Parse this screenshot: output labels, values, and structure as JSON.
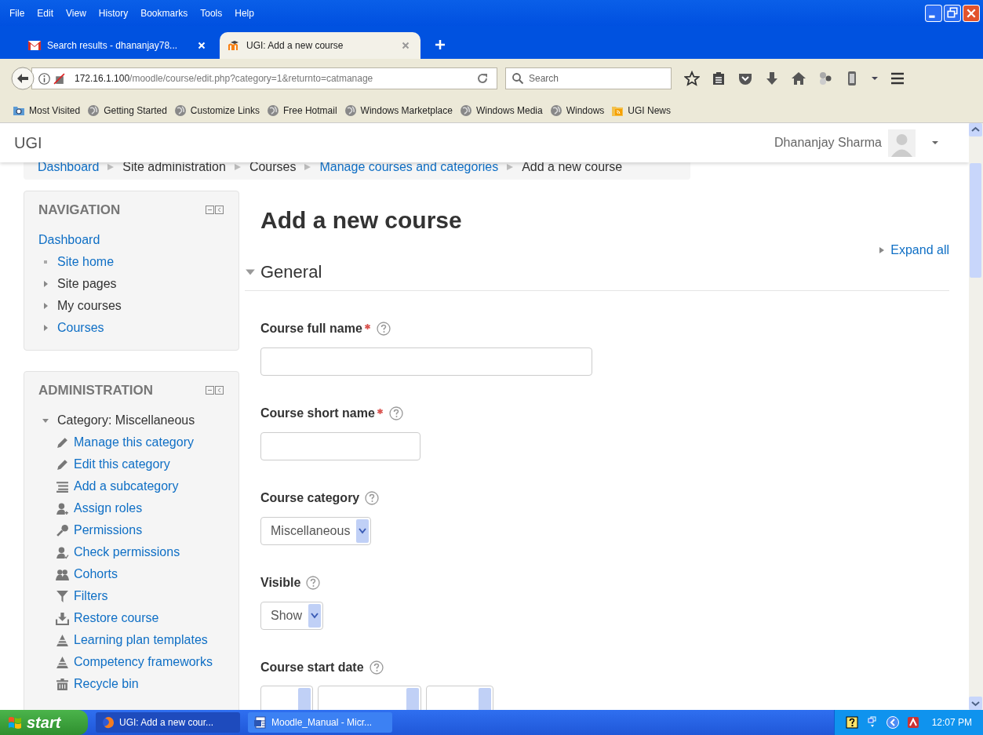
{
  "menu": [
    "File",
    "Edit",
    "View",
    "History",
    "Bookmarks",
    "Tools",
    "Help"
  ],
  "tabs": [
    {
      "title": "Search results - dhananjay78...",
      "kind": "mail",
      "selected": false
    },
    {
      "title": "UGI: Add a new course",
      "kind": "course",
      "selected": true
    }
  ],
  "address": {
    "host": "172.16.1.100",
    "path": "/moodle/course/edit.php?category=1&returnto=catmanage"
  },
  "search": {
    "placeholder": "Search"
  },
  "bookmarks": [
    {
      "label": "Most Visited",
      "kind": "folder"
    },
    {
      "label": "Getting Started",
      "kind": "globe"
    },
    {
      "label": "Customize Links",
      "kind": "globe"
    },
    {
      "label": "Free Hotmail",
      "kind": "globe"
    },
    {
      "label": "Windows Marketplace",
      "kind": "globe"
    },
    {
      "label": "Windows Media",
      "kind": "globe"
    },
    {
      "label": "Windows",
      "kind": "globe"
    },
    {
      "label": "UGI News",
      "kind": "feed"
    }
  ],
  "site": {
    "name": "UGI",
    "user": "Dhananjay Sharma"
  },
  "breadcrumb": [
    {
      "label": "Dashboard",
      "link": true
    },
    {
      "label": "Site administration",
      "link": false
    },
    {
      "label": "Courses",
      "link": false
    },
    {
      "label": "Manage courses and categories",
      "link": true
    },
    {
      "label": "Add a new course",
      "link": false
    }
  ],
  "navigation": {
    "title": "NAVIGATION",
    "items": [
      {
        "label": "Dashboard",
        "kind": "root",
        "link": true,
        "children": [
          {
            "label": "Site home",
            "kind": "leaf",
            "link": true
          },
          {
            "label": "Site pages",
            "kind": "branch",
            "expanded": false,
            "link": false
          },
          {
            "label": "My courses",
            "kind": "branch",
            "expanded": false,
            "link": false
          },
          {
            "label": "Courses",
            "kind": "branch",
            "expanded": false,
            "link": true
          }
        ]
      }
    ]
  },
  "administration": {
    "title": "ADMINISTRATION",
    "items": [
      {
        "label": "Category: Miscellaneous",
        "expanded": true,
        "children": [
          {
            "label": "Manage this category",
            "kind": "edit"
          },
          {
            "label": "Edit this category",
            "kind": "edit"
          },
          {
            "label": "Add a subcategory",
            "kind": "tree"
          },
          {
            "label": "Assign roles",
            "kind": "role"
          },
          {
            "label": "Permissions",
            "kind": "key"
          },
          {
            "label": "Check permissions",
            "kind": "check"
          },
          {
            "label": "Cohorts",
            "kind": "cohort"
          },
          {
            "label": "Filters",
            "kind": "filter"
          },
          {
            "label": "Restore course",
            "kind": "restore"
          },
          {
            "label": "Learning plan templates",
            "kind": "plan"
          },
          {
            "label": "Competency frameworks",
            "kind": "plan"
          },
          {
            "label": "Recycle bin",
            "kind": "bin"
          }
        ]
      }
    ]
  },
  "main": {
    "title": "Add a new course",
    "expand_all": "Expand all",
    "section": {
      "title": "General",
      "expanded": true
    },
    "fields": [
      {
        "label": "Course full name",
        "required": true,
        "kind": "text"
      },
      {
        "label": "Course short name",
        "required": true,
        "kind": "text"
      },
      {
        "label": "Course category",
        "required": false,
        "kind": "select",
        "value": "Miscellaneous"
      },
      {
        "label": "Visible",
        "required": false,
        "kind": "select",
        "value": "Show"
      },
      {
        "label": "Course start date",
        "required": false,
        "kind": "date"
      }
    ]
  },
  "taskbar": {
    "start": "start",
    "windows": [
      {
        "label": "UGI: Add a new cour...",
        "kind": "browser",
        "selected": true
      },
      {
        "label": "Moodle_Manual - Micr...",
        "kind": "document",
        "selected": false
      }
    ],
    "clock": "12:07 PM"
  }
}
